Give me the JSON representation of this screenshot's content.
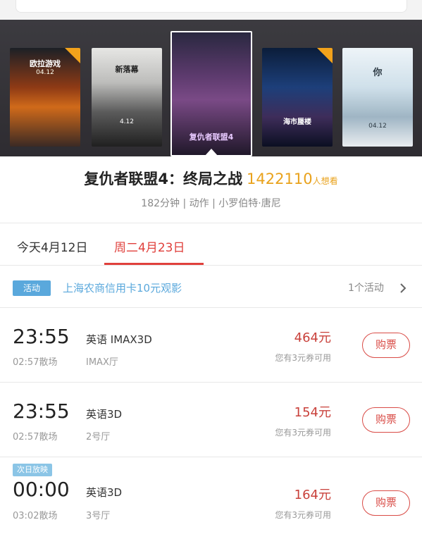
{
  "movie": {
    "title": "复仇者联盟4：终局之战",
    "want_count": "1422110",
    "want_unit": "人想看",
    "meta": "182分钟 | 动作 | 小罗伯特·唐尼"
  },
  "posters": [
    {
      "title": "欧拉游戏",
      "date": "04.12"
    },
    {
      "title": "新落幕",
      "date": "4.12"
    },
    {
      "title": "复仇者联盟4",
      "date": ""
    },
    {
      "title": "海市蜃楼",
      "date": ""
    },
    {
      "title": "你",
      "date": "04.12"
    }
  ],
  "tabs": [
    {
      "label": "今天4月12日",
      "active": false
    },
    {
      "label": "周二4月23日",
      "active": true
    }
  ],
  "promo": {
    "tag": "活动",
    "text": "上海农商信用卡10元观影",
    "count": "1个活动"
  },
  "showtimes": [
    {
      "time": "23:55",
      "end": "02:57散场",
      "lang": "英语 IMAX3D",
      "hall": "IMAX厅",
      "price": "464元",
      "coupon": "您有3元券可用",
      "buy": "购票"
    },
    {
      "time": "23:55",
      "end": "02:57散场",
      "lang": "英语3D",
      "hall": "2号厅",
      "price": "154元",
      "coupon": "您有3元券可用",
      "buy": "购票"
    },
    {
      "time": "00:00",
      "end": "03:02散场",
      "lang": "英语3D",
      "hall": "3号厅",
      "price": "164元",
      "coupon": "您有3元券可用",
      "buy": "购票"
    }
  ],
  "next_day_tag": "次日放映",
  "colors": {
    "accent": "#e0403c",
    "promo": "#5aa8dc",
    "highlight": "#e9a21c"
  }
}
